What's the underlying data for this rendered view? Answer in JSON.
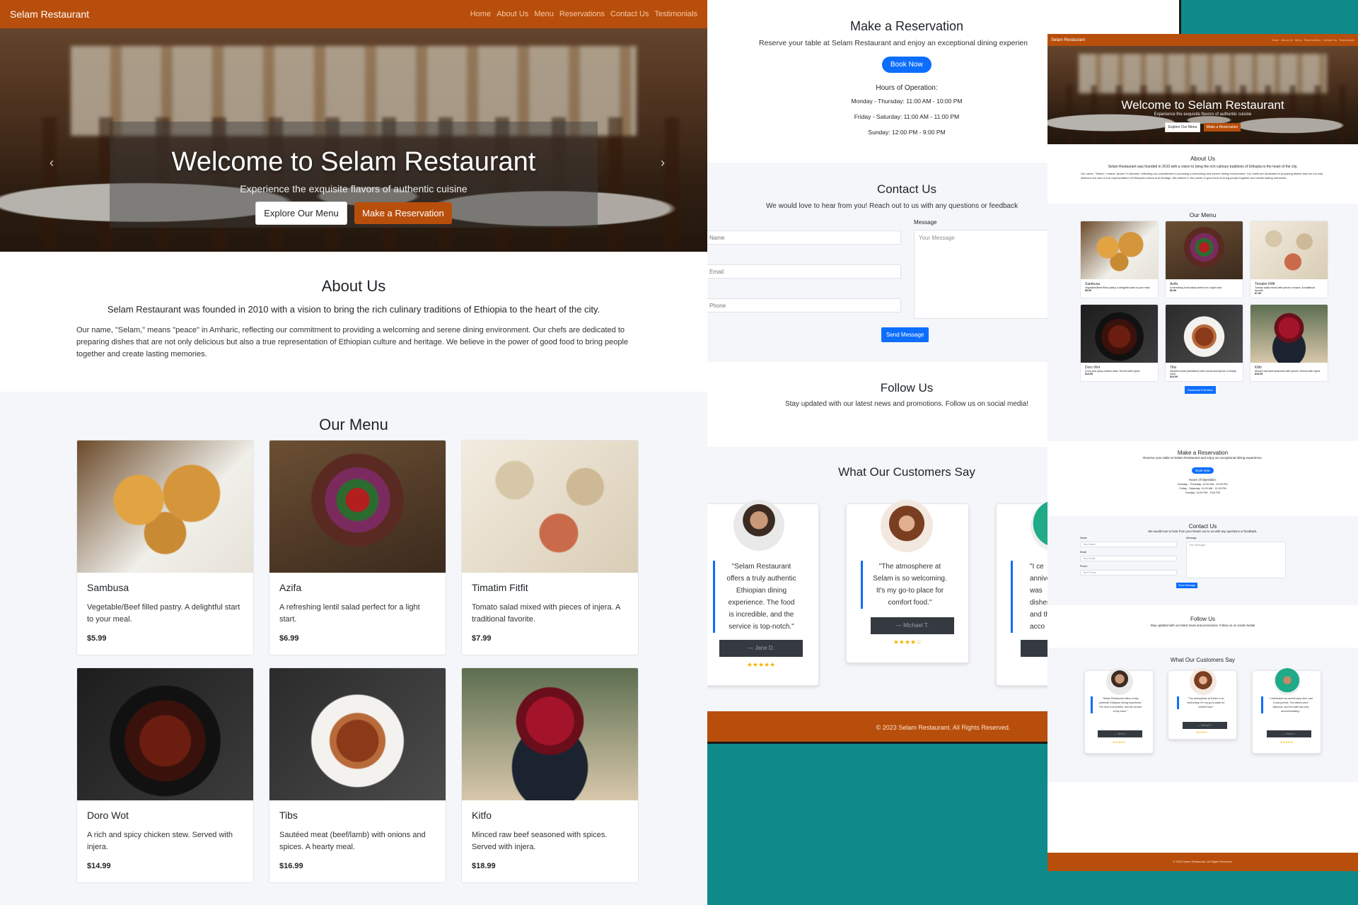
{
  "brand": "Selam Restaurant",
  "nav": [
    "Home",
    "About Us",
    "Menu",
    "Reservations",
    "Contact Us",
    "Testimonials"
  ],
  "hero": {
    "title": "Welcome to Selam Restaurant",
    "subtitle": "Experience the exquisite flavors of authentic cuisine",
    "btn_menu": "Explore Our Menu",
    "btn_reserve": "Make a Reservation"
  },
  "about": {
    "title": "About Us",
    "lead": "Selam Restaurant was founded in 2010 with a vision to bring the rich culinary traditions of Ethiopia to the heart of the city.",
    "body": "Our name, \"Selam,\" means \"peace\" in Amharic, reflecting our commitment to providing a welcoming and serene dining environment. Our chefs are dedicated to preparing dishes that are not only delicious but also a true representation of Ethiopian culture and heritage. We believe in the power of good food to bring people together and create lasting memories."
  },
  "menu": {
    "title": "Our Menu",
    "download": "Download Full Menu",
    "items": [
      {
        "name": "Sambusa",
        "desc": "Vegetable/Beef filled pastry. A delightful start to your meal.",
        "price": "$5.99"
      },
      {
        "name": "Azifa",
        "desc": "A refreshing lentil salad perfect for a light start.",
        "price": "$6.99"
      },
      {
        "name": "Timatim Fitfit",
        "desc": "Tomato salad mixed with pieces of injera. A traditional favorite.",
        "price": "$7.99"
      },
      {
        "name": "Doro Wot",
        "desc": "A rich and spicy chicken stew. Served with injera.",
        "price": "$14.99"
      },
      {
        "name": "Tibs",
        "desc": "Sautéed meat (beef/lamb) with onions and spices. A hearty meal.",
        "price": "$16.99"
      },
      {
        "name": "Kitfo",
        "desc": "Minced raw beef seasoned with spices. Served with injera.",
        "price": "$18.99"
      }
    ]
  },
  "reservation": {
    "title": "Make a Reservation",
    "text": "Reserve your table at Selam Restaurant and enjoy an exceptional dining experience.",
    "text_cropped": "Reserve your table at Selam Restaurant and enjoy an exceptional dining experien",
    "button": "Book Now",
    "hours_title": "Hours of Operation:",
    "hours": [
      "Monday - Thursday: 11:00 AM - 10:00 PM",
      "Friday - Saturday: 11:00 AM - 11:00 PM",
      "Sunday: 12:00 PM - 9:00 PM"
    ]
  },
  "contact": {
    "title": "Contact Us",
    "text": "We would love to hear from you! Reach out to us with any questions or feedback.",
    "text_cropped": "We would love to hear from you! Reach out to us with any questions or feedback",
    "label_name": "Name",
    "label_email": "Email",
    "label_phone": "Phone",
    "label_message": "Message",
    "ph_name": "Name",
    "ph_email": "Email",
    "ph_phone": "Phone",
    "ph_name_full": "Your Name",
    "ph_email_full": "Your Email",
    "ph_phone_full": "Your Phone",
    "ph_message": "Your Message",
    "button": "Send Message"
  },
  "follow": {
    "title": "Follow Us",
    "text": "Stay updated with our latest news and promotions. Follow us on social media!"
  },
  "testimonials": {
    "title": "What Our Customers Say",
    "items": [
      {
        "quote": "\"Selam Restaurant offers a truly authentic Ethiopian dining experience. The food is incredible, and the service is top-notch.\"",
        "author": "— Jane D.",
        "stars": "★★★★★"
      },
      {
        "quote": "\"The atmosphere at Selam is so welcoming. It's my go-to place for comfort food.\"",
        "author": "— Michael T.",
        "stars": "★★★★☆"
      },
      {
        "quote": "\"I celebrated my anniversary here, and it was perfect. The dishes were delicious, and the staff was very accommodating.\"",
        "author": "— Sarah L.",
        "stars": "★★★★★"
      }
    ],
    "partial_quote_lines": [
      "\"I ce",
      "annivers",
      "was",
      "dishes",
      "and the",
      "acco"
    ]
  },
  "footer": "© 2023 Selam Restaurant. All Rights Reserved.",
  "colors": {
    "primary": "#b84e0b",
    "accent": "#0d6efd",
    "background": "#0f8a8a"
  }
}
